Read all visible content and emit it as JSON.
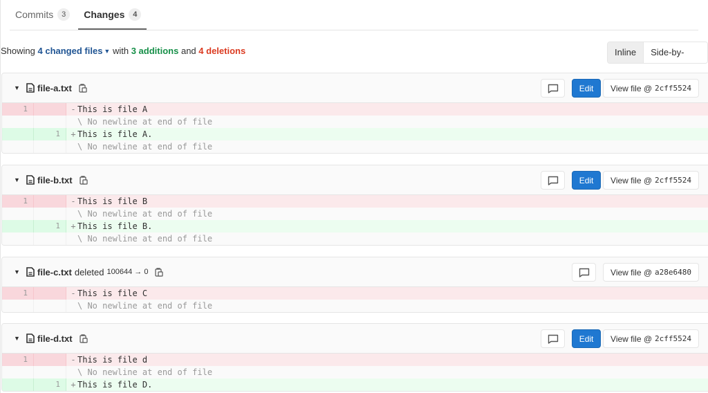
{
  "tabs": [
    {
      "label": "Commits",
      "count": "3",
      "active": false
    },
    {
      "label": "Changes",
      "count": "4",
      "active": true
    }
  ],
  "summary": {
    "prefix": "Showing",
    "changed_files": "4 changed files",
    "with": "with",
    "additions": "3 additions",
    "and": "and",
    "deletions": "4 deletions"
  },
  "view_toggle": {
    "options": [
      "Inline",
      "Side-by-side"
    ],
    "selected": "Inline"
  },
  "colors": {
    "accent": "#1f78d1",
    "additions": "#168f48",
    "deletions": "#db3b21",
    "link": "#1f5493"
  },
  "files": [
    {
      "name": "file-a.txt",
      "status": "",
      "mode": "",
      "edit_label": "Edit",
      "view_label": "View file @",
      "sha": "2cff5524",
      "lines": [
        {
          "type": "del",
          "old": "1",
          "new": "",
          "sign": "-",
          "text": "This is file A"
        },
        {
          "type": "meta",
          "old": "",
          "new": "",
          "sign": "",
          "text": "\\ No newline at end of file"
        },
        {
          "type": "add",
          "old": "",
          "new": "1",
          "sign": "+",
          "text": "This is file A."
        },
        {
          "type": "meta",
          "old": "",
          "new": "",
          "sign": "",
          "text": "\\ No newline at end of file"
        }
      ]
    },
    {
      "name": "file-b.txt",
      "status": "",
      "mode": "",
      "edit_label": "Edit",
      "view_label": "View file @",
      "sha": "2cff5524",
      "lines": [
        {
          "type": "del",
          "old": "1",
          "new": "",
          "sign": "-",
          "text": "This is file B"
        },
        {
          "type": "meta",
          "old": "",
          "new": "",
          "sign": "",
          "text": "\\ No newline at end of file"
        },
        {
          "type": "add",
          "old": "",
          "new": "1",
          "sign": "+",
          "text": "This is file B."
        },
        {
          "type": "meta",
          "old": "",
          "new": "",
          "sign": "",
          "text": "\\ No newline at end of file"
        }
      ]
    },
    {
      "name": "file-c.txt",
      "status": "deleted",
      "mode": "100644 → 0",
      "edit_label": "",
      "view_label": "View file @",
      "sha": "a28e6480",
      "lines": [
        {
          "type": "del",
          "old": "1",
          "new": "",
          "sign": "-",
          "text": "This is file C"
        },
        {
          "type": "meta",
          "old": "",
          "new": "",
          "sign": "",
          "text": "\\ No newline at end of file"
        }
      ]
    },
    {
      "name": "file-d.txt",
      "status": "",
      "mode": "",
      "edit_label": "Edit",
      "view_label": "View file @",
      "sha": "2cff5524",
      "lines": [
        {
          "type": "del",
          "old": "1",
          "new": "",
          "sign": "-",
          "text": "This is file d"
        },
        {
          "type": "meta",
          "old": "",
          "new": "",
          "sign": "",
          "text": "\\ No newline at end of file"
        },
        {
          "type": "add",
          "old": "",
          "new": "1",
          "sign": "+",
          "text": "This is file D."
        }
      ]
    }
  ]
}
